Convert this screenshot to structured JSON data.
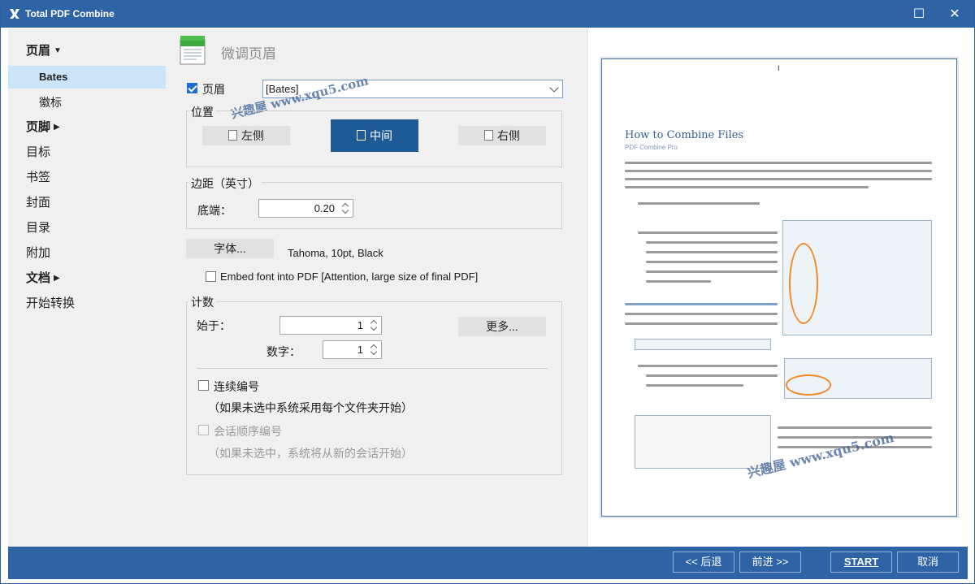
{
  "window": {
    "title": "Total PDF Combine",
    "controls": {
      "maximize": "☐",
      "close": "✕"
    }
  },
  "sidebar": {
    "items": [
      {
        "label": "页眉",
        "kind": "group",
        "expanded": true
      },
      {
        "label": "Bates",
        "kind": "sub",
        "active": true
      },
      {
        "label": "徽标",
        "kind": "sub"
      },
      {
        "label": "页脚",
        "kind": "group",
        "expanded": false
      },
      {
        "label": "目标",
        "kind": "plain"
      },
      {
        "label": "书签",
        "kind": "plain"
      },
      {
        "label": "封面",
        "kind": "plain"
      },
      {
        "label": "目录",
        "kind": "plain"
      },
      {
        "label": "附加",
        "kind": "plain"
      },
      {
        "label": "文档",
        "kind": "group",
        "expanded": false
      },
      {
        "label": "开始转换",
        "kind": "plain"
      }
    ]
  },
  "panel": {
    "section_title": "微调页眉",
    "header_checkbox": {
      "label": "页眉",
      "checked": true
    },
    "header_type": {
      "value": "[Bates]"
    },
    "position": {
      "legend": "位置",
      "left": "左侧",
      "center": "中间",
      "right": "右侧",
      "selected": "center"
    },
    "margin": {
      "legend": "边距（英寸）",
      "bottom_label": "底端：",
      "bottom_value": "0.20"
    },
    "font": {
      "button": "字体...",
      "value": "Tahoma, 10pt, Black",
      "embed_label": "Embed font into PDF  [Attention, large size of final PDF]",
      "embed_checked": false
    },
    "counter": {
      "legend": "计数",
      "start_label": "始于：",
      "start_value": "1",
      "digits_label": "数字：",
      "digits_value": "1",
      "more_button": "更多...",
      "continuous_label": "连续编号",
      "continuous_note": "（如果未选中系统采用每个文件夹开始）",
      "continuous_checked": false,
      "session_label": "会话顺序编号",
      "session_note": "（如果未选中，系统将从新的会话开始）",
      "session_checked": false
    }
  },
  "preview": {
    "header_mark": "I",
    "heading": "How to Combine Files",
    "subheading": "PDF Combine Pro",
    "watermark": "兴趣屋 www.xqu5.com"
  },
  "watermark_top": "兴趣屋 www.xqu5.com",
  "footer": {
    "back": "<< 后退",
    "next": "前进 >>",
    "start": "START",
    "cancel": "取消"
  }
}
